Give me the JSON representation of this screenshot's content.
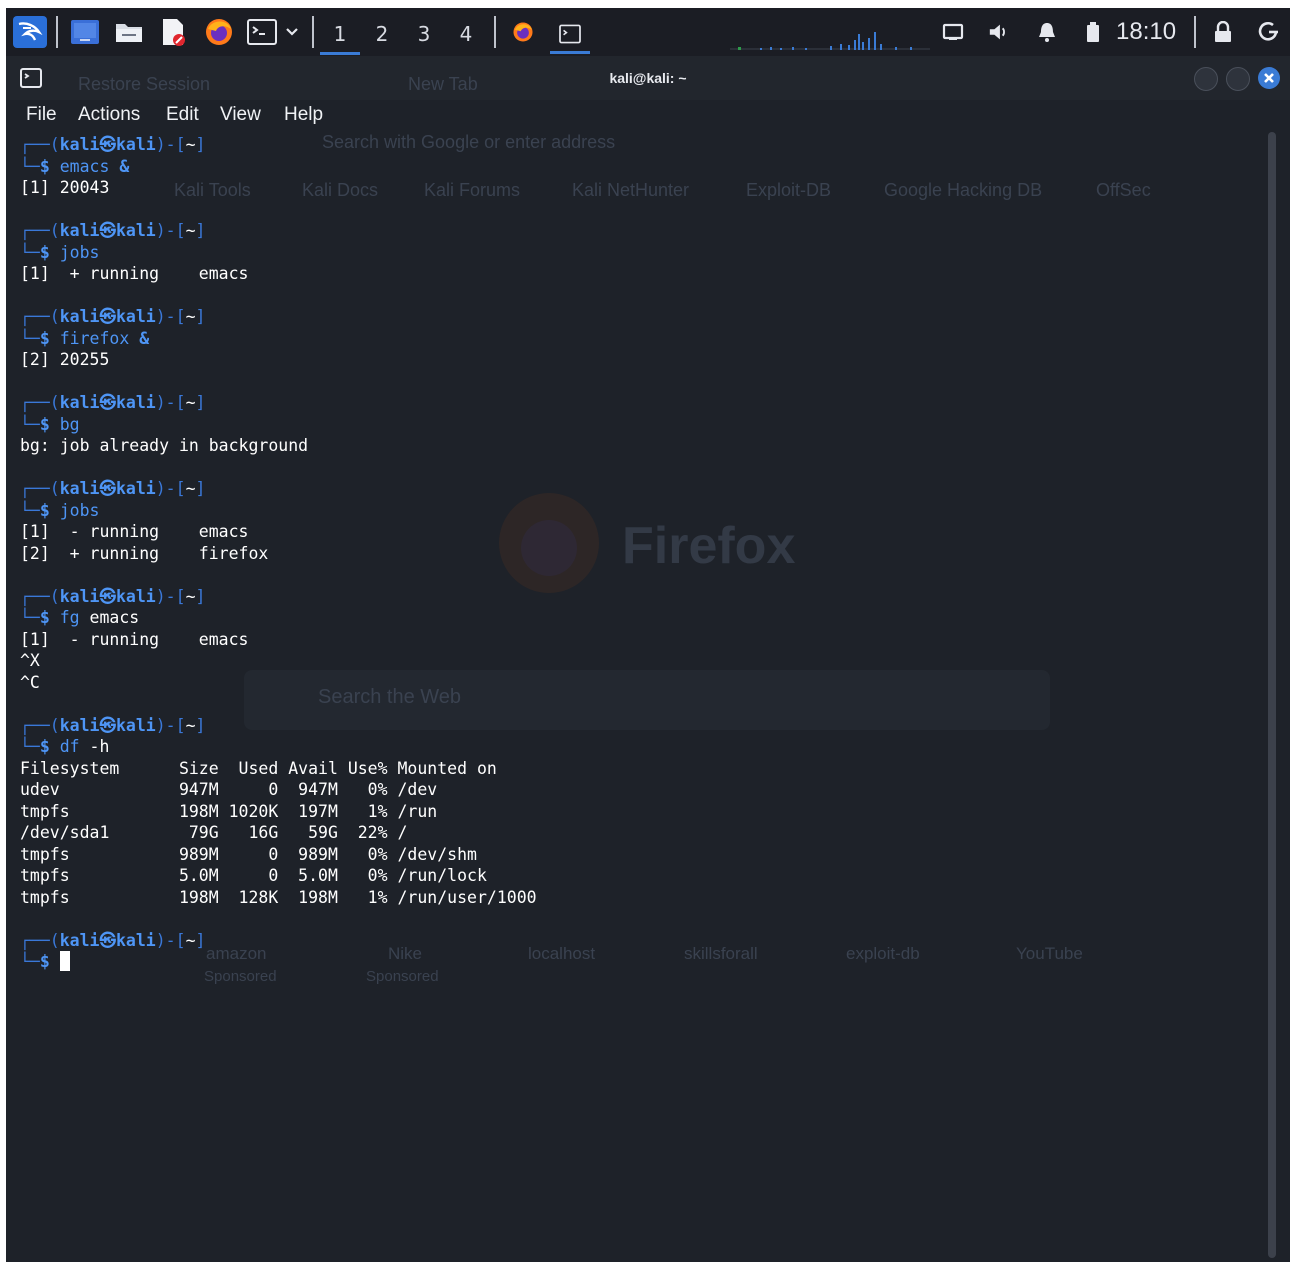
{
  "taskbar": {
    "workspaces": [
      "1",
      "2",
      "3",
      "4"
    ],
    "active_workspace": "1",
    "clock": "18:10",
    "icons": [
      "kali-menu-icon",
      "desktop-icon",
      "file-manager-icon",
      "text-editor-icon",
      "firefox-icon",
      "terminal-icon",
      "chevron-down-icon",
      "firefox-task-icon",
      "terminal-task-icon",
      "network-icon",
      "volume-icon",
      "notification-bell-icon",
      "battery-icon",
      "lock-icon",
      "power-icon"
    ]
  },
  "window": {
    "title": "kali@kali: ~",
    "menu": [
      "File",
      "Actions",
      "Edit",
      "View",
      "Help"
    ]
  },
  "prompt": {
    "user": "kali",
    "host": "kali",
    "dir": "~"
  },
  "terminal": {
    "blocks": [
      {
        "cmd": "emacs",
        "args": " &",
        "out": [
          "[1] 20043"
        ]
      },
      {
        "cmd": "jobs",
        "args": "",
        "out": [
          "[1]  + running    emacs"
        ]
      },
      {
        "cmd": "firefox",
        "args": " &",
        "out": [
          "[2] 20255"
        ]
      },
      {
        "cmd": "bg",
        "args": "",
        "out": [
          "bg: job already in background"
        ]
      },
      {
        "cmd": "jobs",
        "args": "",
        "out": [
          "[1]  - running    emacs",
          "[2]  + running    firefox"
        ]
      },
      {
        "cmd": "fg",
        "args": " emacs",
        "out": [
          "[1]  - running    emacs",
          "^X",
          "^C"
        ]
      },
      {
        "cmd": "df",
        "args": " -h",
        "out": [
          "Filesystem      Size  Used Avail Use% Mounted on",
          "udev            947M     0  947M   0% /dev",
          "tmpfs           198M 1020K  197M   1% /run",
          "/dev/sda1        79G   16G   59G  22% /",
          "tmpfs           989M     0  989M   0% /dev/shm",
          "tmpfs           5.0M     0  5.0M   0% /run/lock",
          "tmpfs           198M  128K  198M   1% /run/user/1000"
        ]
      }
    ]
  },
  "background_browser": {
    "brand": "Firefox",
    "tabs": [
      "Restore Session",
      "New Tab"
    ],
    "search_placeholder": "Search with Google or enter address",
    "search_web": "Search the Web",
    "bookmarks": [
      "Kali Tools",
      "Kali Docs",
      "Kali Forums",
      "Kali NetHunter",
      "Exploit-DB",
      "Google Hacking DB",
      "OffSec"
    ],
    "tiles": [
      "amazon",
      "Nike",
      "localhost",
      "skillsforall",
      "exploit-db",
      "YouTube"
    ],
    "sponsored": "Sponsored"
  },
  "colors": {
    "terminal_bg": "#1e2229",
    "prompt_blue": "#4e95f5",
    "accent": "#3a7bd5",
    "close_button": "#3a7bd5"
  }
}
